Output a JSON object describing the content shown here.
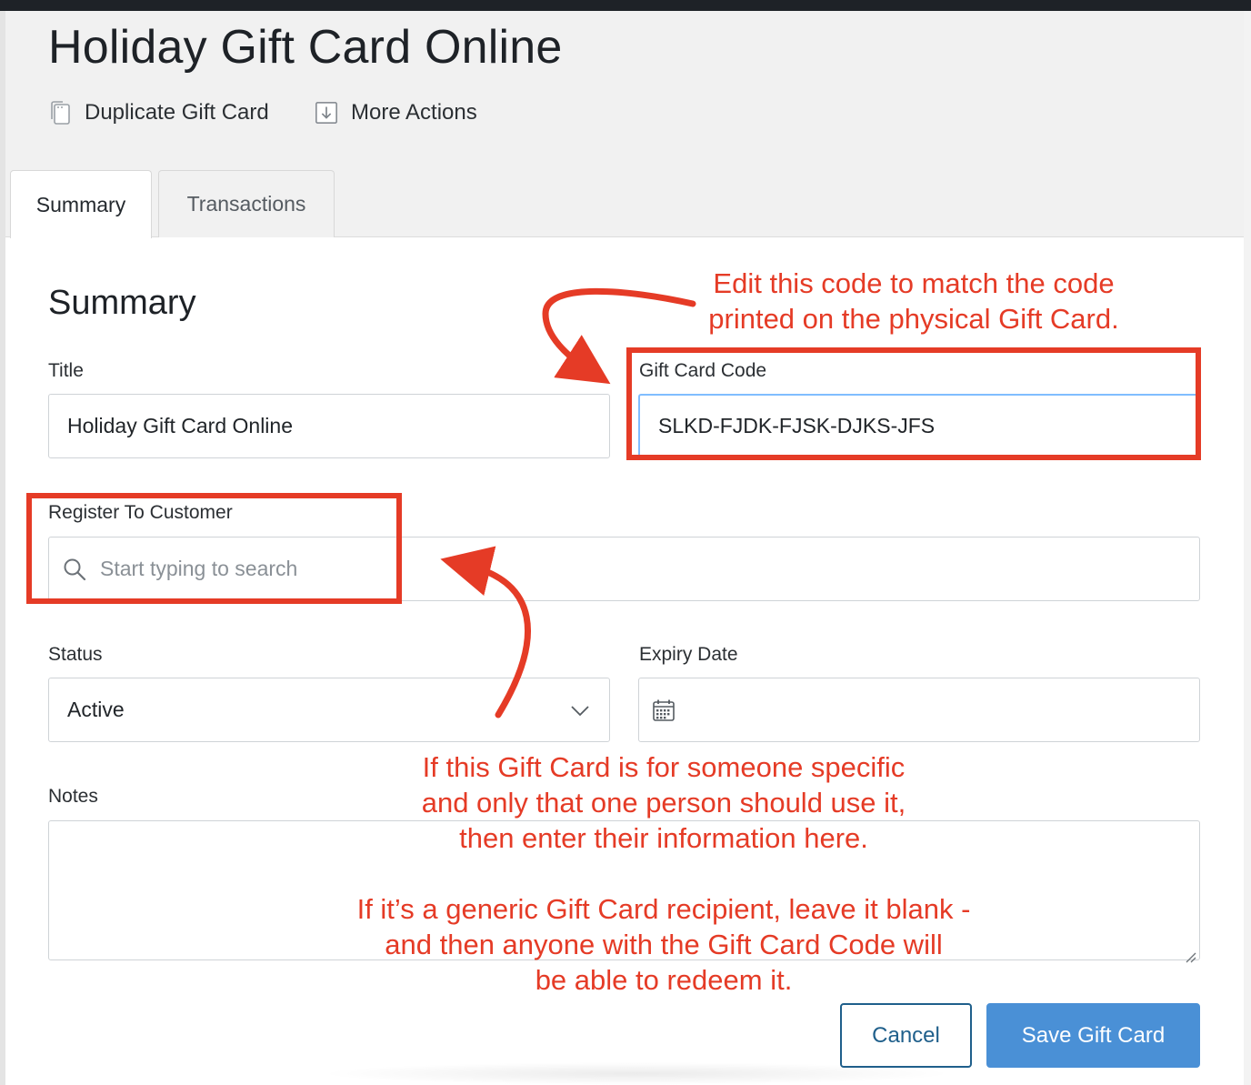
{
  "page": {
    "title": "Holiday Gift Card Online",
    "actions": {
      "duplicate": "Duplicate Gift Card",
      "more": "More Actions"
    },
    "tabs": [
      {
        "label": "Summary",
        "active": true
      },
      {
        "label": "Transactions",
        "active": false
      }
    ]
  },
  "summary": {
    "heading": "Summary",
    "title_field": {
      "label": "Title",
      "value": "Holiday Gift Card Online"
    },
    "code_field": {
      "label": "Gift Card Code",
      "value": "SLKD-FJDK-FJSK-DJKS-JFS"
    },
    "customer_field": {
      "label": "Register To Customer",
      "placeholder": "Start typing to search",
      "value": ""
    },
    "status_field": {
      "label": "Status",
      "value": "Active"
    },
    "expiry_field": {
      "label": "Expiry Date",
      "value": ""
    },
    "notes_field": {
      "label": "Notes",
      "value": ""
    }
  },
  "buttons": {
    "cancel": "Cancel",
    "save": "Save Gift Card"
  },
  "annotations": {
    "code_note": "Edit this code to match the code\nprinted on the physical Gift Card.",
    "customer_note": "If this Gift Card is for someone specific\nand only that one person should use it,\nthen enter their information here.\n\nIf it’s a generic Gift Card recipient, leave it blank -\nand then anyone with the Gift Card Code will\nbe able to redeem it."
  },
  "colors": {
    "accent": "#4a90d6",
    "annotation": "#e53b26",
    "cancel_border": "#1f5f8b"
  },
  "icons": {
    "duplicate": "copy-icon",
    "more": "download-icon",
    "search": "search-icon",
    "status": "chevron-down-icon",
    "expiry": "calendar-icon"
  }
}
